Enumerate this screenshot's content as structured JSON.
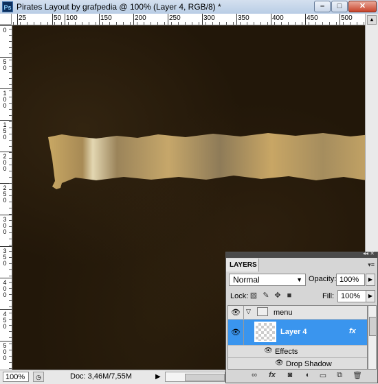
{
  "window": {
    "title": "Pirates Layout by grafpedia @ 100% (Layer 4, RGB/8) *",
    "app_icon": "Ps",
    "controls": [
      "minimize",
      "maximize",
      "close"
    ]
  },
  "ruler": {
    "horizontal_ticks": [
      "25",
      "50",
      "100",
      "150",
      "200",
      "250",
      "300",
      "350",
      "400",
      "450",
      "500"
    ],
    "vertical_ticks": [
      "0",
      "50",
      "100",
      "150",
      "200",
      "250",
      "300",
      "350",
      "400",
      "450",
      "500"
    ]
  },
  "statusbar": {
    "zoom": "100%",
    "doc": "Doc: 3,46M/7,55M"
  },
  "layers_panel": {
    "tab_label": "LAYERS",
    "blend_mode": "Normal",
    "opacity_label": "Opacity:",
    "opacity_value": "100%",
    "lock_label": "Lock:",
    "fill_label": "Fill:",
    "fill_value": "100%",
    "layers": [
      {
        "name": "menu",
        "type": "group",
        "expanded": true
      },
      {
        "name": "Layer 4",
        "type": "layer",
        "selected": true,
        "fx": "fx"
      },
      {
        "name": "Effects",
        "type": "effects"
      },
      {
        "name": "Drop Shadow",
        "type": "effect"
      }
    ],
    "bottom_icons": [
      "link-icon",
      "fx-icon",
      "mask-icon",
      "adjustment-icon",
      "folder-icon",
      "new-layer-icon",
      "trash-icon"
    ]
  },
  "colors": {
    "canvas_bg": "#221709",
    "selected_layer": "#3a95ee",
    "parchment": "#c9a864"
  }
}
